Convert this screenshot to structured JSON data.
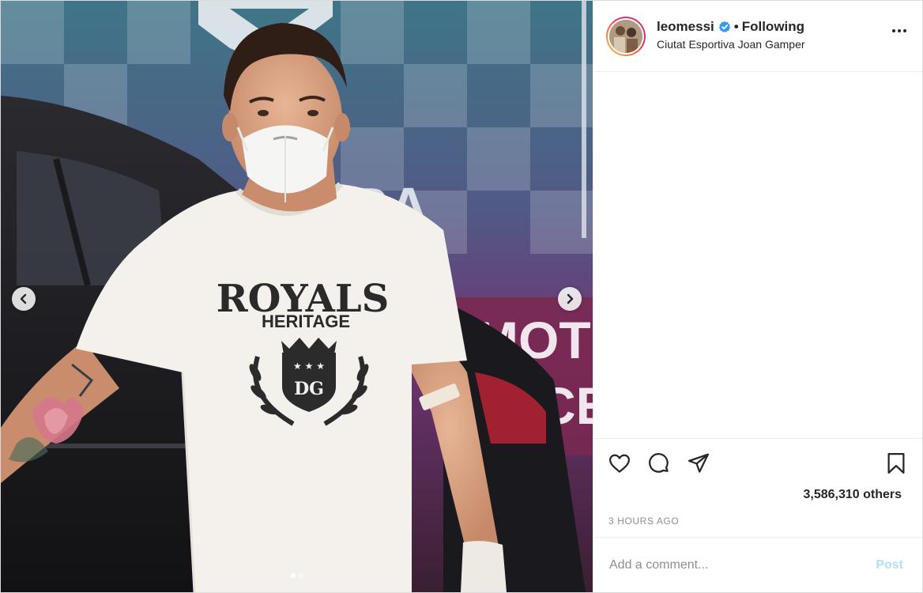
{
  "post": {
    "username": "leomessi",
    "separator": "•",
    "follow_status": "Following",
    "location": "Ciutat Esportiva Joan Gamper",
    "verified": true
  },
  "media": {
    "shirt_text_main": "ROYALS",
    "shirt_text_sub": "HERITAGE",
    "shirt_crest_text": "DG",
    "background_sign_text_1": "MOT",
    "background_sign_text_2": "CE",
    "background_sign_text_3": "RA",
    "carousel_total": 2,
    "carousel_active": 1
  },
  "actions": {
    "likes_text": "3,586,310 others",
    "timestamp": "3 HOURS AGO"
  },
  "comment_box": {
    "placeholder": "Add a comment...",
    "post_label": "Post"
  },
  "colors": {
    "text": "#262626",
    "muted": "#8e8e8e",
    "post_disabled": "#b2dffc",
    "verified_blue": "#3897f0"
  },
  "icons": {
    "like": "heart-icon",
    "comment": "comment-icon",
    "share": "paper-plane-icon",
    "save": "bookmark-icon",
    "more": "more-options-icon",
    "verified": "verified-badge-icon",
    "prev": "chevron-left-icon",
    "next": "chevron-right-icon"
  }
}
